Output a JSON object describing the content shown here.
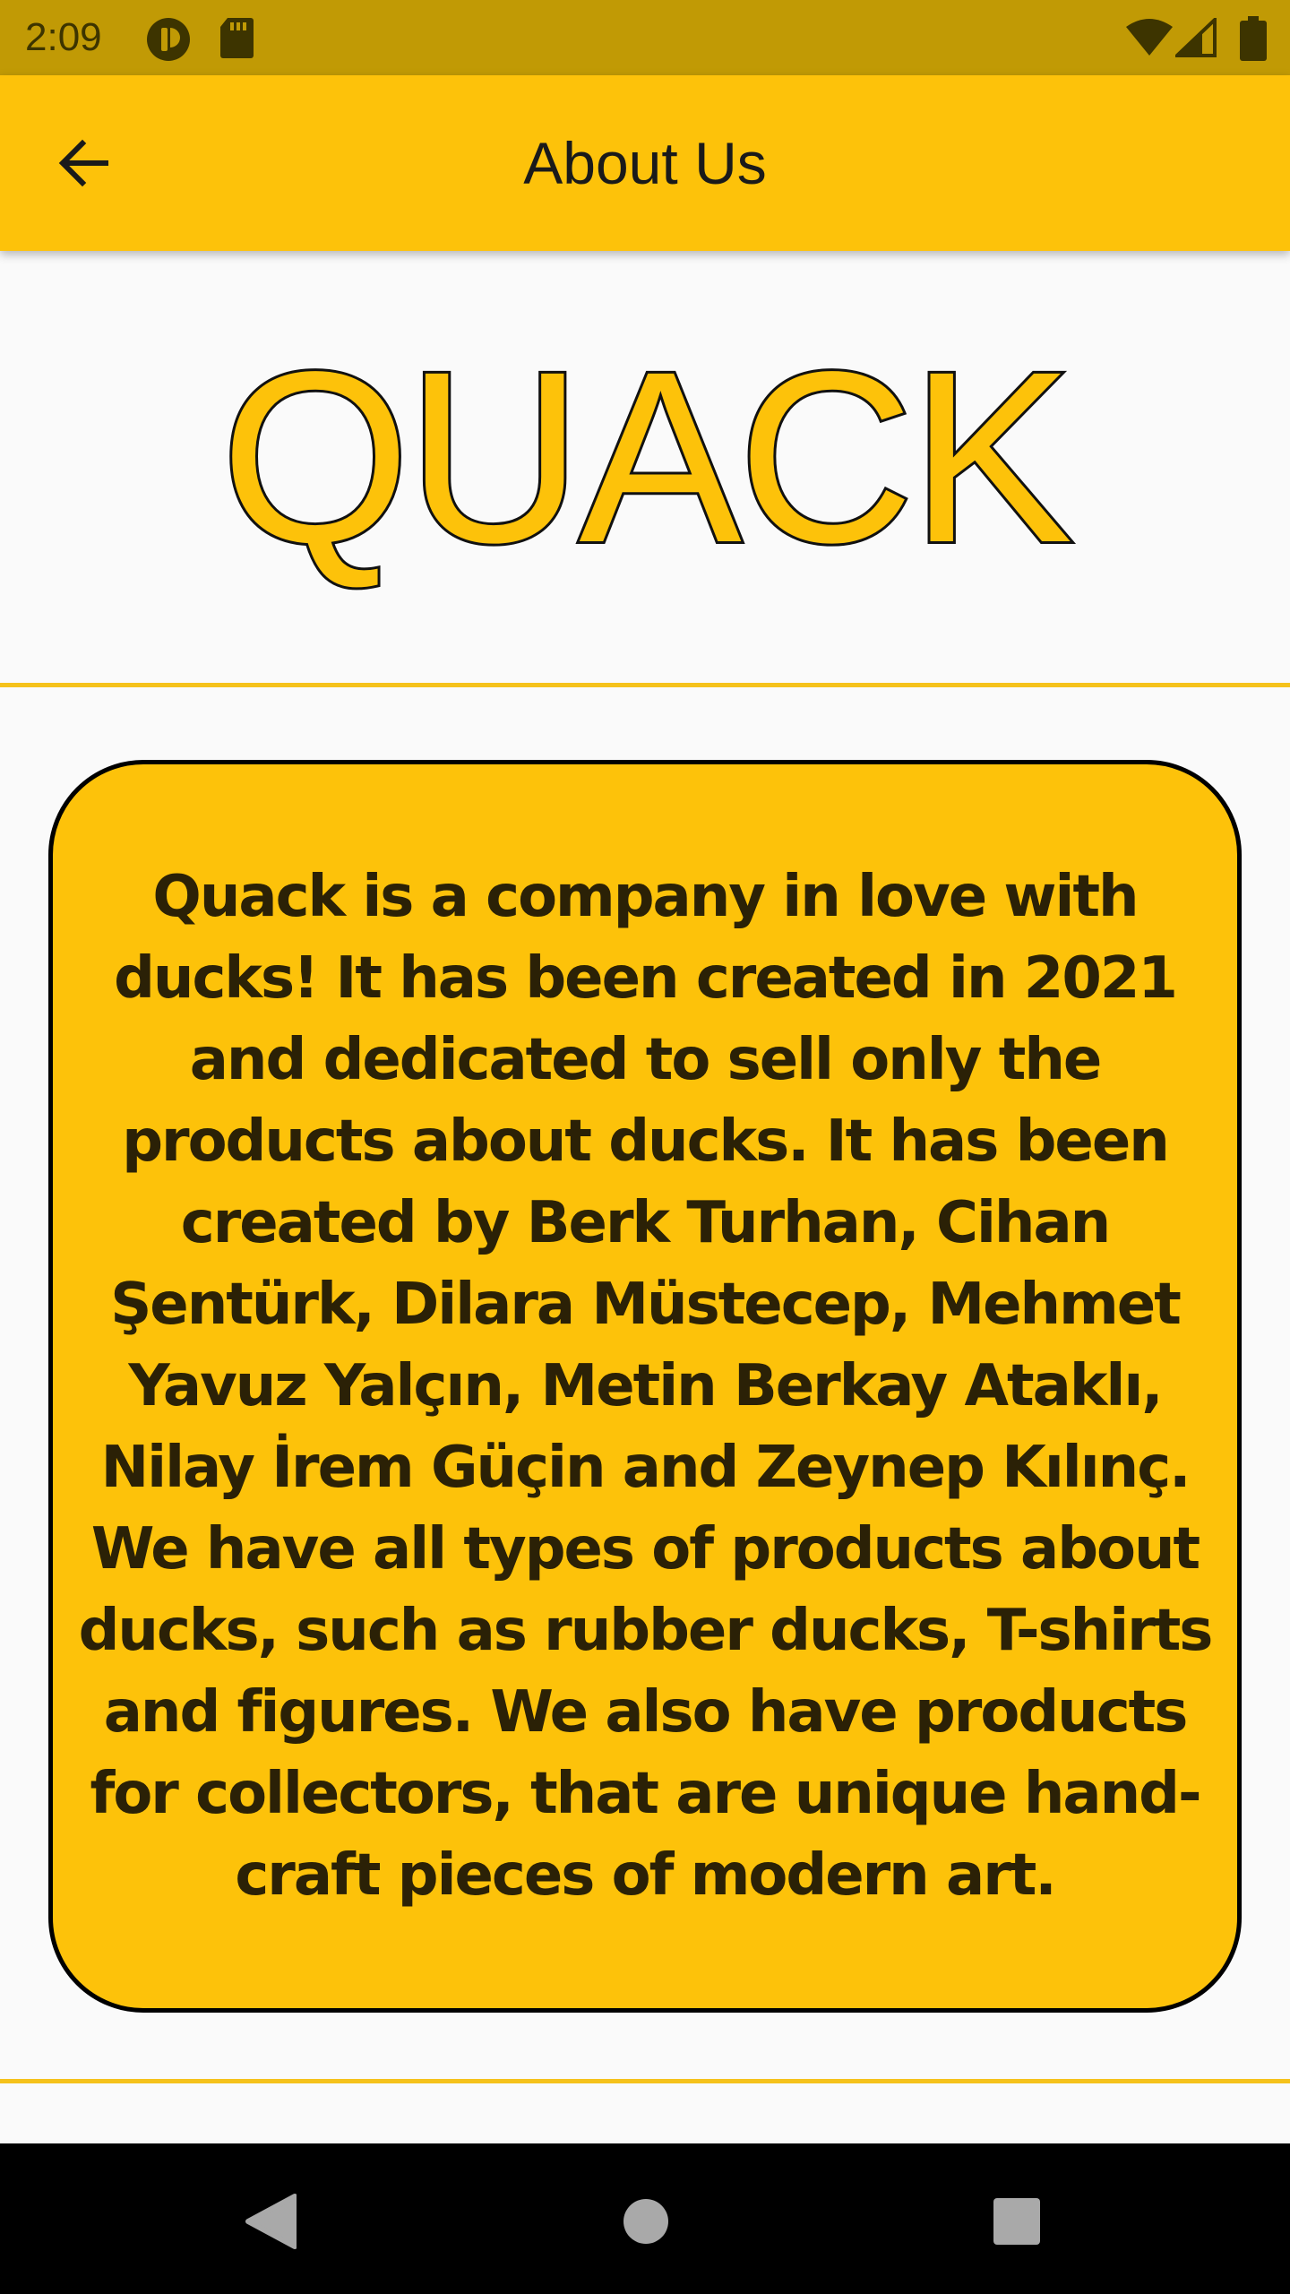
{
  "status_bar": {
    "time": "2:09",
    "icons": [
      "sync-icon",
      "sd-card-icon",
      "wifi-icon",
      "signal-icon",
      "battery-icon"
    ]
  },
  "app_bar": {
    "title": "About Us",
    "back_icon": "arrow-back-icon"
  },
  "logo": {
    "text": "QUACK"
  },
  "about_card": {
    "text": "Quack is a company in love with ducks! It has been created in 2021 and dedicated to sell only the products about ducks. It has been created by Berk Turhan, Cihan Şentürk, Dilara Müstecep, Mehmet Yavuz Yalçın, Metin Berkay Ataklı, Nilay İrem Güçin and Zeynep Kılınç. We have all types of products about ducks, such as rubber ducks, T-shirts and figures. We also have products for collectors, that are unique hand-craft pieces of modern art."
  },
  "nav_bar": {
    "buttons": [
      "back-triangle-icon",
      "home-circle-icon",
      "recents-square-icon"
    ]
  },
  "colors": {
    "accent": "#fdc20a",
    "status_bar": "#c19a05",
    "divider": "#f5c21b",
    "text_dark": "#2b2106"
  }
}
